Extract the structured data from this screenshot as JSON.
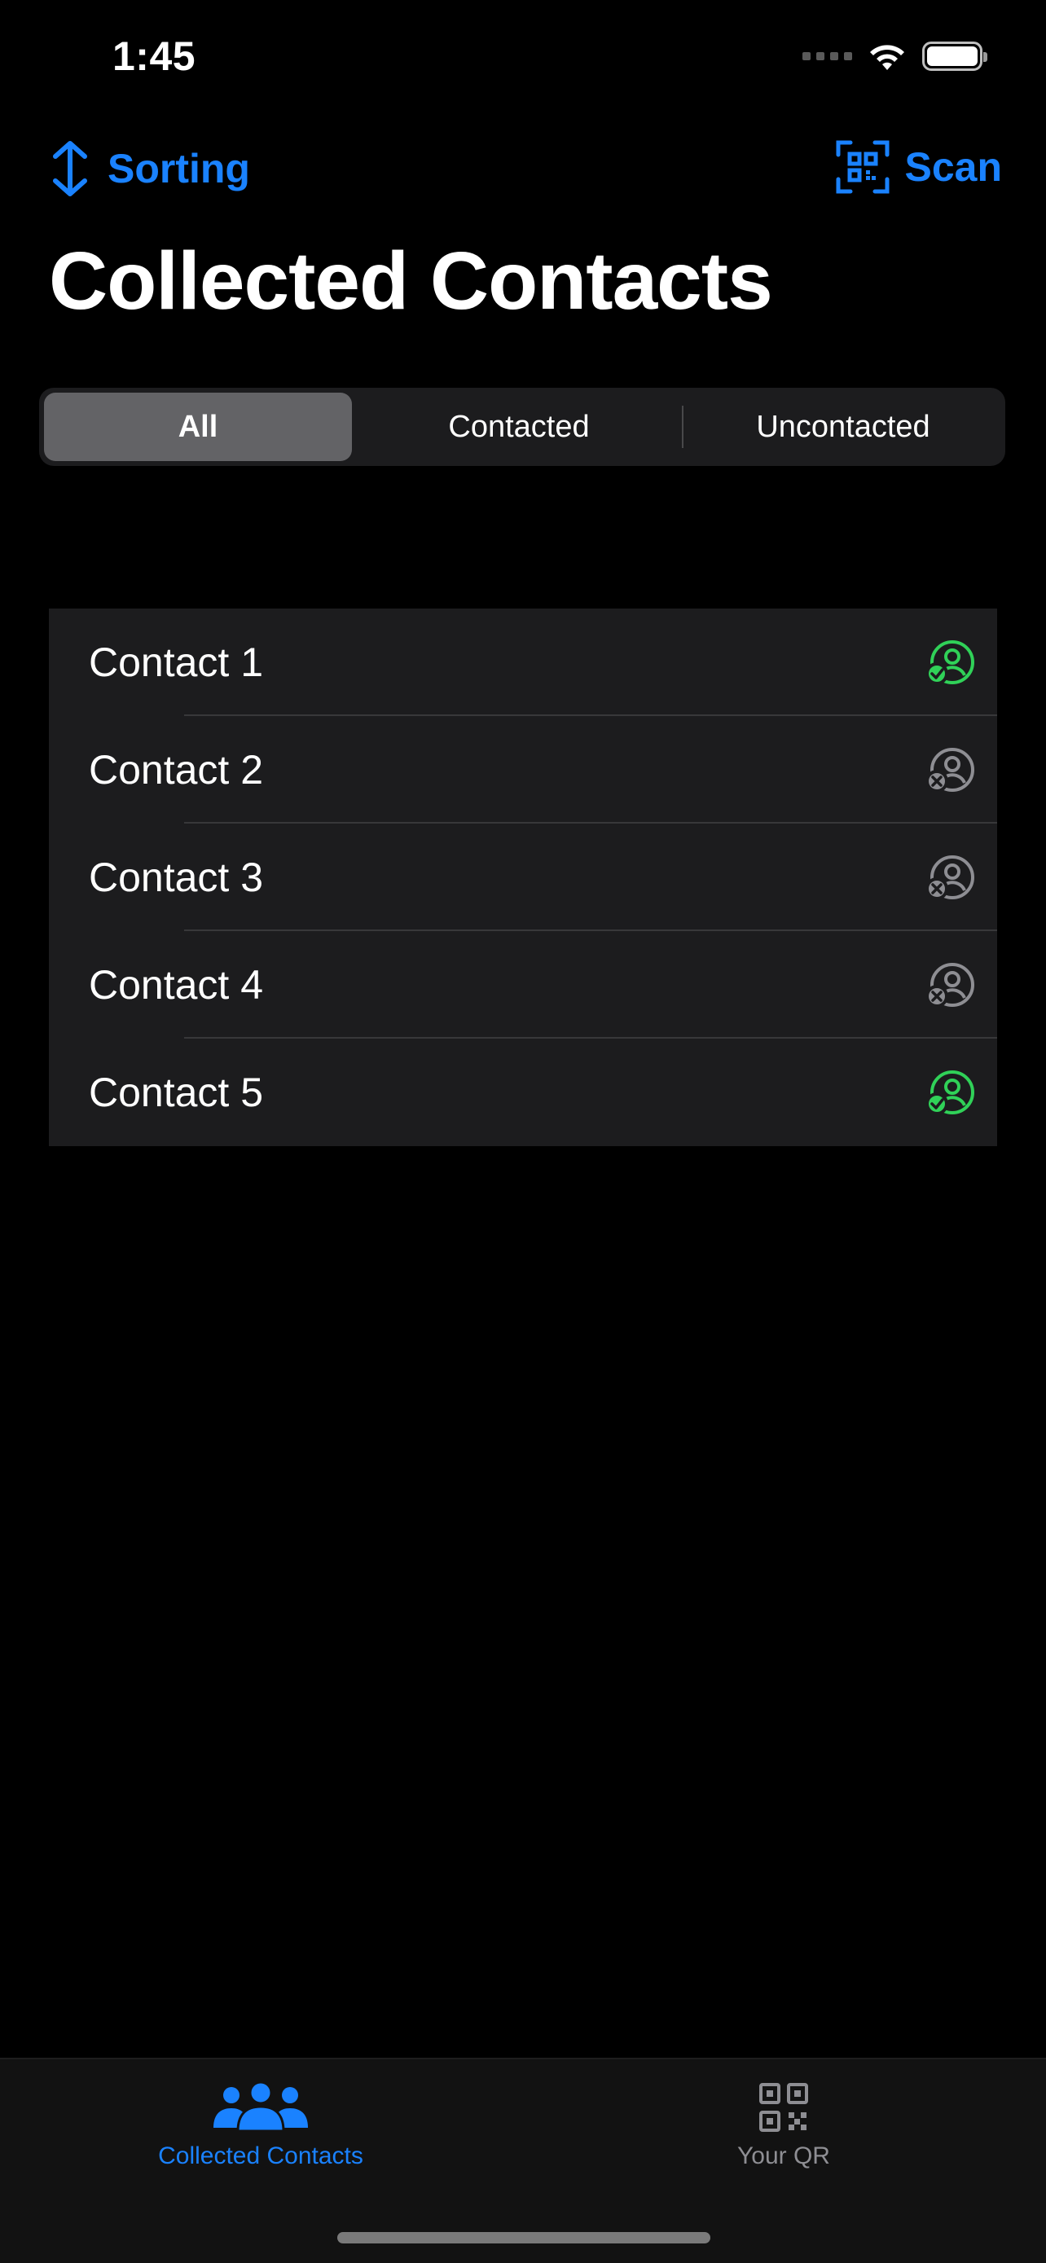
{
  "status_bar": {
    "time": "1:45",
    "icons": [
      "signal-dots-icon",
      "wifi-icon",
      "battery-icon"
    ]
  },
  "nav": {
    "sorting_label": "Sorting",
    "sorting_icon": "up-down-arrow-icon",
    "scan_label": "Scan",
    "scan_icon": "qr-scan-icon"
  },
  "title": "Collected Contacts",
  "segments": [
    {
      "label": "All",
      "selected": true
    },
    {
      "label": "Contacted",
      "selected": false
    },
    {
      "label": "Uncontacted",
      "selected": false
    }
  ],
  "contacts": [
    {
      "name": "Contact 1",
      "status": "contacted"
    },
    {
      "name": "Contact 2",
      "status": "uncontacted"
    },
    {
      "name": "Contact 3",
      "status": "uncontacted"
    },
    {
      "name": "Contact 4",
      "status": "uncontacted"
    },
    {
      "name": "Contact 5",
      "status": "contacted"
    }
  ],
  "tabs": [
    {
      "label": "Collected Contacts",
      "icon": "people-icon",
      "active": true
    },
    {
      "label": "Your QR",
      "icon": "qr-code-icon",
      "active": false
    }
  ],
  "colors": {
    "accent": "#1a82ff",
    "contacted": "#30d158",
    "uncontacted": "#8e8e93"
  }
}
